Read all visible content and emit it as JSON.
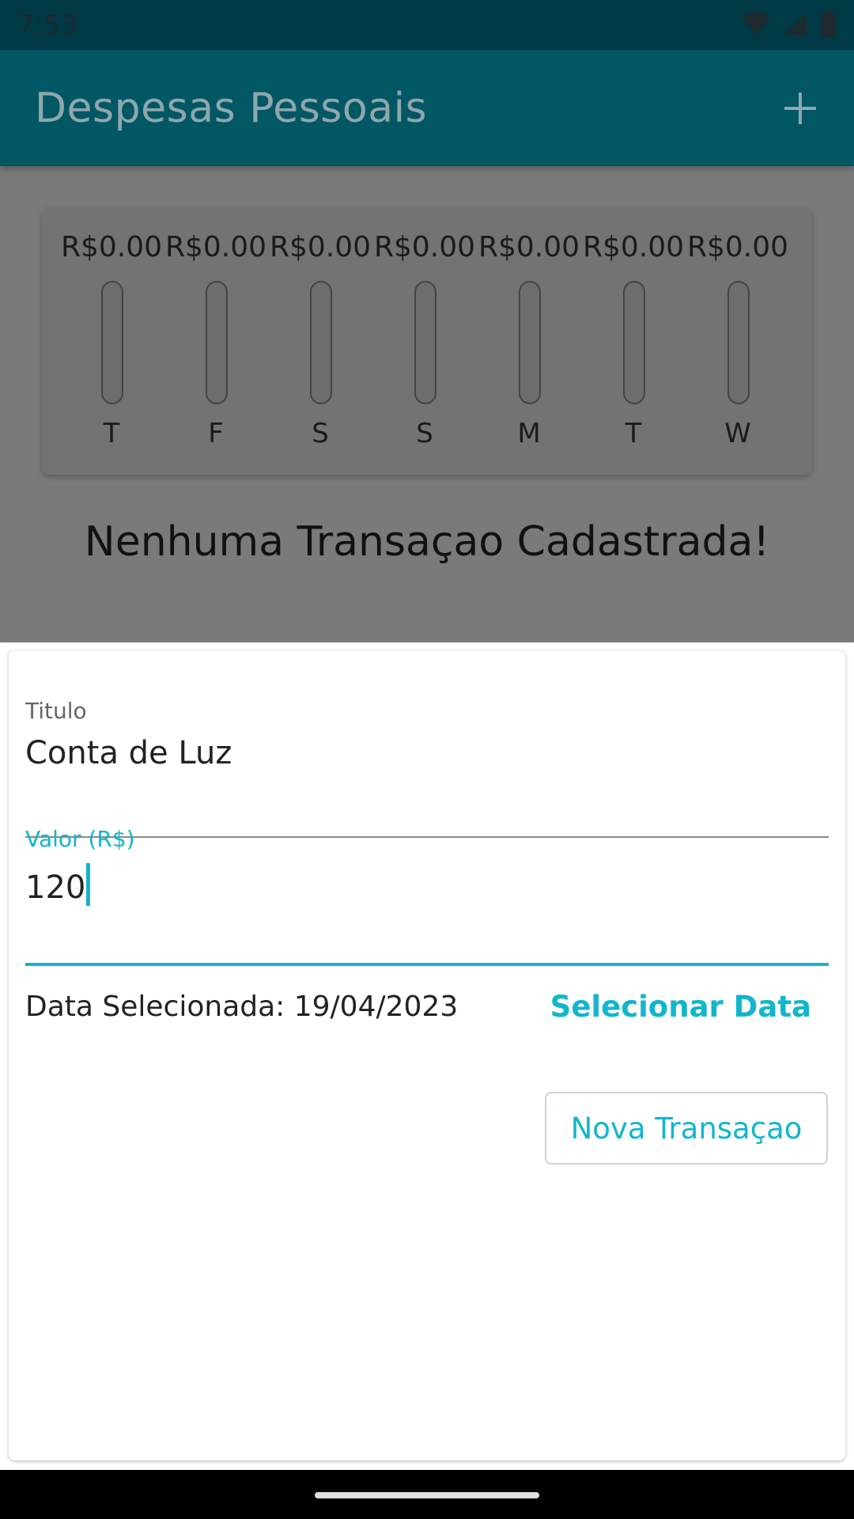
{
  "status_bar": {
    "time": "7:53",
    "icons": [
      "wifi-icon",
      "signal-icon",
      "battery-icon"
    ]
  },
  "app_bar": {
    "title": "Despesas Pessoais",
    "add_icon": "plus-icon"
  },
  "chart_data": {
    "type": "bar",
    "categories": [
      "T",
      "F",
      "S",
      "S",
      "M",
      "T",
      "W"
    ],
    "values": [
      0,
      0,
      0,
      0,
      0,
      0,
      0
    ],
    "value_labels": [
      "R$0.00",
      "R$0.00",
      "R$0.00",
      "R$0.00",
      "R$0.00",
      "R$0.00",
      "R$0.00"
    ]
  },
  "empty_message": "Nenhuma Transaçao Cadastrada!",
  "form": {
    "title_label": "Titulo",
    "title_value": "Conta de Luz",
    "value_label": "Valor (R$)",
    "value_value": "120",
    "date_text": "Data Selecionada: 19/04/2023",
    "select_date_label": "Selecionar Data",
    "submit_label": "Nova Transaçao"
  },
  "colors": {
    "accent": "#13b5c9",
    "app_bar": "#025765",
    "status_bar": "#003a47",
    "scrim": "#7a7a7a"
  }
}
